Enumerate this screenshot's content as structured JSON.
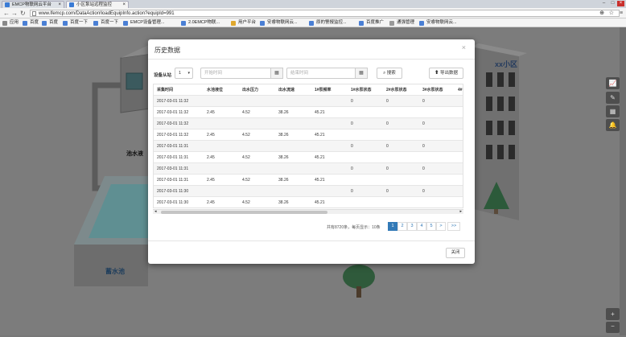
{
  "browser": {
    "tabs": [
      {
        "label": "EMCP物联网云平台"
      },
      {
        "label": "小区泵站远程监控"
      }
    ],
    "url": "www.lfemcp.com/DataAction!loadEquipInfo.action?equipId=991",
    "bookmarks": [
      "应用",
      "百度",
      "百度",
      "百度一下",
      "百度一下",
      "EMCP设备管理...",
      "2.0EMCP物联...",
      "用户平台",
      "安睿物联网云...",
      "原的警报监控...",
      "百度推广",
      "通强管理",
      "安睿物联网云..."
    ]
  },
  "scene": {
    "building_label": "xx小区",
    "pool_label": "池水液",
    "tank_label": "蓄水池"
  },
  "modal": {
    "title": "历史数据",
    "close_glyph": "×",
    "filter_label": "设备从站",
    "device_select": "1",
    "start_placeholder": "开始时间",
    "end_placeholder": "结束时间",
    "search_label": "搜索",
    "export_label": "导出数据",
    "columns": [
      "采集时间",
      "水池液位",
      "出水压力",
      "出水流速",
      "1#泵频率",
      "1#水泵状态",
      "2#水泵状态",
      "3#水泵状态",
      "4#"
    ],
    "rows": [
      [
        "2017-03-01 11:32",
        "",
        "",
        "",
        "",
        "0",
        "0",
        "0",
        ""
      ],
      [
        "2017-03-01 11:32",
        "2.45",
        "4.52",
        "38.26",
        "45.21",
        "",
        "",
        "",
        ""
      ],
      [
        "2017-03-01 11:32",
        "",
        "",
        "",
        "",
        "0",
        "0",
        "0",
        ""
      ],
      [
        "2017-03-01 11:32",
        "2.45",
        "4.52",
        "38.26",
        "45.21",
        "",
        "",
        "",
        ""
      ],
      [
        "2017-03-01 11:31",
        "",
        "",
        "",
        "",
        "0",
        "0",
        "0",
        ""
      ],
      [
        "2017-03-01 11:31",
        "2.45",
        "4.52",
        "38.26",
        "45.21",
        "",
        "",
        "",
        ""
      ],
      [
        "2017-03-01 11:31",
        "",
        "",
        "",
        "",
        "0",
        "0",
        "0",
        ""
      ],
      [
        "2017-03-01 11:31",
        "2.45",
        "4.52",
        "38.26",
        "45.21",
        "",
        "",
        "",
        ""
      ],
      [
        "2017-03-01 11:30",
        "",
        "",
        "",
        "",
        "0",
        "0",
        "0",
        ""
      ],
      [
        "2017-03-01 11:30",
        "2.45",
        "4.52",
        "38.26",
        "45.21",
        "",
        "",
        "",
        ""
      ]
    ],
    "page_info": "共有8720条，每页显示：10条",
    "pages": [
      "1",
      "2",
      "3",
      "4",
      "5",
      ">",
      ">>"
    ],
    "close_button": "关闭"
  },
  "colors": {
    "accent": "#337ab7",
    "overlay": "#7c7c7c"
  }
}
